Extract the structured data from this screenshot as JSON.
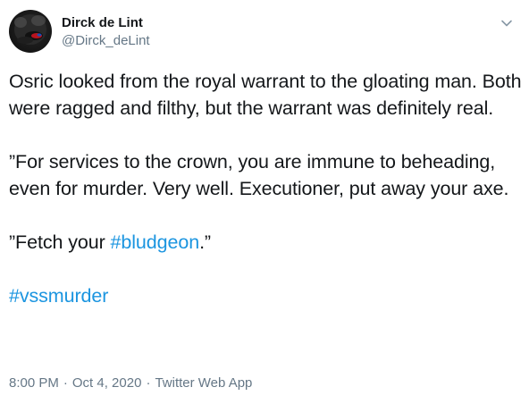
{
  "author": {
    "display_name": "Dirck de Lint",
    "handle": "@Dirck_deLint",
    "avatar_icon": "avatar-image"
  },
  "menu": {
    "icon": "chevron-down-icon"
  },
  "tweet": {
    "paragraph1": "Osric looked from the royal warrant to the gloating man. Both were ragged and filthy, but the warrant was definitely real.",
    "paragraph2": "”For services to the crown, you are immune to beheading, even for murder. Very well. Executioner, put away your axe.",
    "paragraph3_prefix": "”Fetch your ",
    "paragraph3_hashtag": "#bludgeon",
    "paragraph3_suffix": ".”",
    "hashtag_line": "#vssmurder"
  },
  "meta": {
    "time": "8:00 PM",
    "separator1": "·",
    "date": "Oct 4, 2020",
    "separator2": "·",
    "source": "Twitter Web App"
  },
  "colors": {
    "text": "#14171a",
    "secondary": "#657786",
    "link": "#1b95e0",
    "background": "#ffffff"
  }
}
